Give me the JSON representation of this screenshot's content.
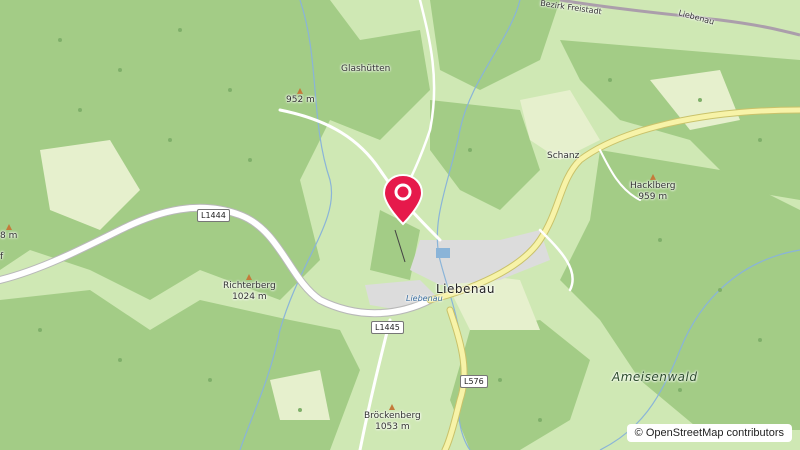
{
  "map": {
    "place_labels": [
      {
        "id": "glashutten",
        "text": "Glashütten"
      },
      {
        "id": "schanz",
        "text": "Schanz"
      },
      {
        "id": "liebenau",
        "text": "Liebenau"
      },
      {
        "id": "left-fragment-f",
        "text": "f"
      },
      {
        "id": "top-road",
        "text": "Bezirk Freistadt"
      },
      {
        "id": "top-road-2",
        "text": "Liebenau"
      }
    ],
    "peaks": [
      {
        "id": "952",
        "name": "",
        "elevation": "952 m"
      },
      {
        "id": "hacklberg",
        "name": "Hacklberg",
        "elevation": "959 m"
      },
      {
        "id": "richterberg",
        "name": "Richterberg",
        "elevation": "1024 m"
      },
      {
        "id": "brockenberg",
        "name": "Bröckenberg",
        "elevation": "1053 m"
      },
      {
        "id": "left-fragment",
        "name": "",
        "elevation": "8 m"
      }
    ],
    "water_label": "Liebenau",
    "forest_label": "Ameisenwald",
    "road_shields": [
      {
        "id": "l1444",
        "text": "L1444"
      },
      {
        "id": "l1445",
        "text": "L1445"
      },
      {
        "id": "l576",
        "text": "L576"
      }
    ],
    "attribution": "© OpenStreetMap contributors",
    "colors": {
      "forest": "#a3cc86",
      "meadow": "#cfe8b4",
      "light_meadow": "#e6f0cd",
      "road": "#ffffff",
      "primary_road": "#f7f3a8",
      "water": "#8ab4d8",
      "marker": "#e6194b",
      "urban": "#dcdcdc"
    }
  }
}
